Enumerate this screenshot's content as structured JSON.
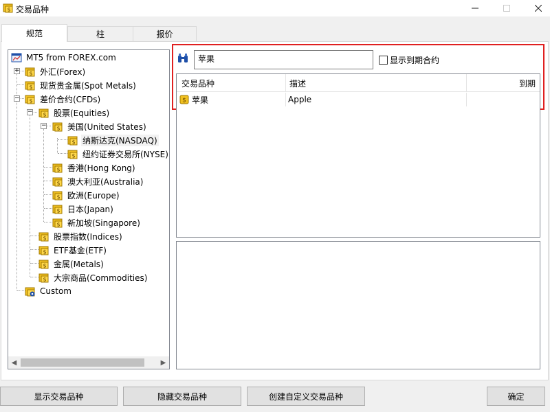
{
  "window": {
    "title": "交易品种",
    "icon": "folder-coin-icon",
    "controls": [
      "minimize-icon",
      "maximize-icon",
      "close-icon"
    ]
  },
  "tabs": [
    {
      "label": "规范",
      "active": true
    },
    {
      "label": "柱",
      "active": false
    },
    {
      "label": "报价",
      "active": false
    }
  ],
  "tree": {
    "root": "MT5 from FOREX.com",
    "nodes": [
      {
        "label": "外汇(Forex)"
      },
      {
        "label": "现货贵金属(Spot Metals)"
      },
      {
        "label": "差价合约(CFDs)"
      },
      {
        "label": "股票(Equities)"
      },
      {
        "label": "美国(United States)"
      },
      {
        "label": "纳斯达克(NASDAQ)"
      },
      {
        "label": "纽约证券交易所(NYSE)"
      },
      {
        "label": "香港(Hong Kong)"
      },
      {
        "label": "澳大利亚(Australia)"
      },
      {
        "label": "欧洲(Europe)"
      },
      {
        "label": "日本(Japan)"
      },
      {
        "label": "新加坡(Singapore)"
      },
      {
        "label": "股票指数(Indices)"
      },
      {
        "label": "ETF基金(ETF)"
      },
      {
        "label": "金属(Metals)"
      },
      {
        "label": "大宗商品(Commodities)"
      },
      {
        "label": "Custom"
      }
    ]
  },
  "search": {
    "value": "苹果",
    "checkbox_label": "显示到期合约",
    "checkbox_checked": false
  },
  "list": {
    "columns": [
      "交易品种",
      "描述",
      "到期"
    ],
    "rows": [
      {
        "symbol": "苹果",
        "description": "Apple",
        "expiry": ""
      }
    ]
  },
  "buttons": {
    "show": "显示交易品种",
    "hide": "隐藏交易品种",
    "create": "创建自定义交易品种",
    "ok": "确定"
  },
  "colors": {
    "highlight_frame": "#e02020",
    "icon_gold": "#f0b400",
    "icon_blue": "#1e4fa8"
  }
}
